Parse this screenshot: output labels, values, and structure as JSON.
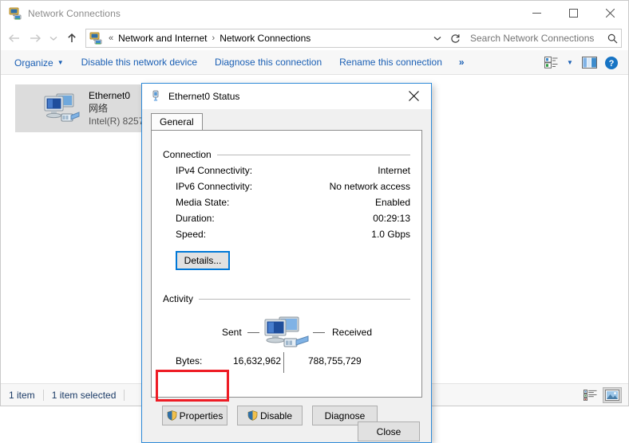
{
  "window": {
    "title": "Network Connections",
    "title_icon": "network-connections-icon",
    "buttons": {
      "minimize": "minimize-icon",
      "maximize": "maximize-icon",
      "close": "close-icon"
    }
  },
  "navigation": {
    "back": "back-arrow-icon",
    "forward": "forward-arrow-icon",
    "recent": "recent-locations-chevron-icon",
    "up": "up-arrow-icon"
  },
  "address_bar": {
    "icon": "network-connections-icon",
    "overflow": "«",
    "crumbs": [
      "Network and Internet",
      "Network Connections"
    ],
    "separator": "›",
    "dropdown": "chevron-down-icon",
    "refresh": "refresh-icon"
  },
  "search": {
    "placeholder": "Search Network Connections",
    "value": "",
    "icon": "search-icon"
  },
  "command_bar": {
    "items": [
      {
        "label": "Organize",
        "has_caret": true
      },
      {
        "label": "Disable this network device",
        "has_caret": false
      },
      {
        "label": "Diagnose this connection",
        "has_caret": false
      },
      {
        "label": "Rename this connection",
        "has_caret": false
      }
    ],
    "overflow": "»",
    "view_options_icon": "view-options-icon",
    "view_options_caret": "chevron-down-icon",
    "preview_pane_icon": "preview-pane-icon",
    "help_icon": "help-icon"
  },
  "content": {
    "items": [
      {
        "name": "Ethernet0",
        "network": "网络",
        "device": "Intel(R) 8257",
        "icon": "network-adapter-icon",
        "selected": true
      }
    ]
  },
  "status_bar": {
    "item_count": "1 item",
    "selection": "1 item selected",
    "view_details_icon": "details-view-icon",
    "view_large_icons_icon": "large-icons-view-icon",
    "active_view": "large-icons-view-icon"
  },
  "dialog": {
    "title": "Ethernet0 Status",
    "title_icon": "network-status-icon",
    "close_icon": "close-icon",
    "tabs": [
      {
        "label": "General",
        "active": true
      }
    ],
    "connection": {
      "legend": "Connection",
      "rows": [
        {
          "key": "IPv4 Connectivity:",
          "value": "Internet"
        },
        {
          "key": "IPv6 Connectivity:",
          "value": "No network access"
        },
        {
          "key": "Media State:",
          "value": "Enabled"
        },
        {
          "key": "Duration:",
          "value": "00:29:13"
        },
        {
          "key": "Speed:",
          "value": "1.0 Gbps"
        }
      ],
      "details_button": "Details..."
    },
    "activity": {
      "legend": "Activity",
      "sent_label": "Sent",
      "received_label": "Received",
      "icon": "network-activity-icon",
      "bytes_label": "Bytes:",
      "bytes_sent": "16,632,962",
      "bytes_received": "788,755,729"
    },
    "actions": [
      {
        "label": "Properties",
        "shield": true
      },
      {
        "label": "Disable",
        "shield": true
      },
      {
        "label": "Diagnose",
        "shield": false
      }
    ],
    "close_button": "Close"
  },
  "annotation": {
    "target": "properties-button",
    "color": "#ee1c25"
  },
  "colors": {
    "accent": "#0078d7",
    "dialog_border": "#2e8ad8",
    "link": "#1a5fb4",
    "annotation": "#ee1c25",
    "selection": "#dcdcdc"
  }
}
